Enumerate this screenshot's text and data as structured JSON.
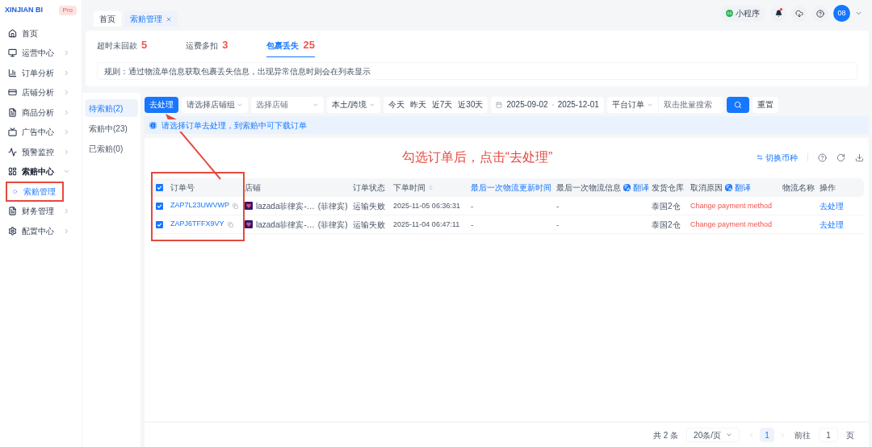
{
  "brand": {
    "name": "XINJIAN BI",
    "badge": "Pro"
  },
  "sidebar": {
    "items": [
      {
        "label": "首页",
        "expanded": false,
        "has_arrow": false
      },
      {
        "label": "运营中心",
        "expanded": false,
        "has_arrow": true
      },
      {
        "label": "订单分析",
        "expanded": false,
        "has_arrow": true
      },
      {
        "label": "店铺分析",
        "expanded": false,
        "has_arrow": true
      },
      {
        "label": "商品分析",
        "expanded": false,
        "has_arrow": true
      },
      {
        "label": "广告中心",
        "expanded": false,
        "has_arrow": true
      },
      {
        "label": "预警监控",
        "expanded": false,
        "has_arrow": true
      },
      {
        "label": "索赔中心",
        "expanded": true,
        "has_arrow": true,
        "children": [
          {
            "label": "索赔管理",
            "selected": true
          }
        ]
      },
      {
        "label": "财务管理",
        "expanded": false,
        "has_arrow": true
      },
      {
        "label": "配置中心",
        "expanded": false,
        "has_arrow": true
      }
    ]
  },
  "page_tabs": [
    {
      "label": "首页",
      "selected": false,
      "closable": false
    },
    {
      "label": "索赔管理",
      "selected": true,
      "closable": true
    }
  ],
  "header": {
    "mini_program": "小程序",
    "has_notification": true,
    "avatar": "08"
  },
  "category_tabs": [
    {
      "label": "超时未回款",
      "count": "5",
      "selected": false
    },
    {
      "label": "运费多扣",
      "count": "3",
      "selected": false
    },
    {
      "label": "包裹丢失",
      "count": "25",
      "selected": true
    }
  ],
  "rule": "规则：通过物流单信息获取包裹丢失信息，出现异常信息时则会在列表显示",
  "status_tabs": [
    {
      "label": "待索赔(2)",
      "selected": true
    },
    {
      "label": "索赔中(23)",
      "selected": false
    },
    {
      "label": "已索赔(0)",
      "selected": false
    }
  ],
  "filters": {
    "process_button": "去处理",
    "store_group": {
      "placeholder": "请选择店铺组"
    },
    "store": {
      "placeholder": "选择店铺"
    },
    "region": "本土/跨境",
    "quick_dates": [
      "今天",
      "昨天",
      "近7天",
      "近30天"
    ],
    "date_start": "2025-09-02",
    "date_end": "2025-12-01",
    "order_type": "平台订单",
    "search": {
      "placeholder": "双击批量搜索"
    },
    "reset": "重置"
  },
  "notice": "请选择订单去处理，到索赔中可下载订单",
  "annotation": "勾选订单后，点击“去处理”",
  "toolbar": {
    "switch_currency": "切换币种"
  },
  "table": {
    "all_checked": true,
    "columns": [
      {
        "label": "订单号",
        "kind": "plain"
      },
      {
        "label": "店铺",
        "kind": "plain"
      },
      {
        "label": "订单状态",
        "kind": "plain"
      },
      {
        "label": "下单时间",
        "kind": "sort"
      },
      {
        "label": "最后一次物流更新时间",
        "kind": "link"
      },
      {
        "label": "最后一次物流信息",
        "kind": "translate",
        "action": "翻译"
      },
      {
        "label": "发货仓库",
        "kind": "plain"
      },
      {
        "label": "取消原因",
        "kind": "translate",
        "action": "翻译"
      },
      {
        "label": "物流名称",
        "kind": "plain"
      },
      {
        "label": "操作",
        "kind": "plain"
      }
    ],
    "rows": [
      {
        "checked": true,
        "order_no": "ZAP7L23UWVWP",
        "store": "lazada菲律宾-…",
        "store_region": "(菲律宾)",
        "status": "运输失败",
        "time": "2025-11-05 06:36:31",
        "last_update": "-",
        "last_info": "-",
        "warehouse": "泰国2仓",
        "reason": "Change payment method",
        "action": "去处理"
      },
      {
        "checked": true,
        "order_no": "ZAPJ6TFFX9VY",
        "store": "lazada菲律宾-…",
        "store_region": "(菲律宾)",
        "status": "运输失败",
        "time": "2025-11-04 06:47:11",
        "last_update": "-",
        "last_info": "-",
        "warehouse": "泰国2仓",
        "reason": "Change payment method",
        "action": "去处理"
      }
    ]
  },
  "pagination": {
    "total": "共 2 条",
    "page_size": "20条/页",
    "pages": [
      {
        "label": "1",
        "selected": true
      }
    ],
    "goto_label": "前往",
    "goto_value": "1",
    "page_unit": "页"
  }
}
